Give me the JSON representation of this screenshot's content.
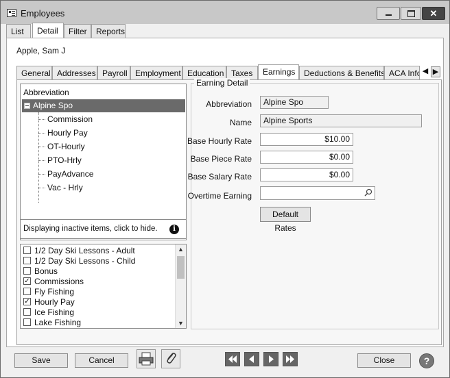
{
  "window": {
    "title": "Employees"
  },
  "top_tabs": [
    {
      "label": "List"
    },
    {
      "label": "Detail"
    },
    {
      "label": "Filter"
    },
    {
      "label": "Reports"
    }
  ],
  "employee": {
    "name": "Apple, Sam J"
  },
  "sub_tabs": [
    {
      "label": "General"
    },
    {
      "label": "Addresses"
    },
    {
      "label": "Payroll"
    },
    {
      "label": "Employment"
    },
    {
      "label": "Education"
    },
    {
      "label": "Taxes"
    },
    {
      "label": "Earnings"
    },
    {
      "label": "Deductions & Benefits"
    },
    {
      "label": "ACA Info"
    }
  ],
  "tree": {
    "header": "Abbreviation",
    "root": "Alpine Spo",
    "children": [
      "Commission",
      "Hourly Pay",
      "OT-Hourly",
      "PTO-Hrly",
      "PayAdvance",
      "Vac - Hrly"
    ]
  },
  "inactive_notice": "Displaying inactive items, click to hide.",
  "checklist": [
    {
      "label": "1/2 Day Ski Lessons - Adult",
      "checked": false
    },
    {
      "label": "1/2 Day Ski Lessons - Child",
      "checked": false
    },
    {
      "label": "Bonus",
      "checked": false
    },
    {
      "label": "Commissions",
      "checked": true
    },
    {
      "label": "Fly Fishing",
      "checked": false
    },
    {
      "label": "Hourly Pay",
      "checked": true
    },
    {
      "label": "Ice Fishing",
      "checked": false
    },
    {
      "label": "Lake Fishing",
      "checked": false
    }
  ],
  "detail": {
    "group_title": "Earning Detail",
    "abbreviation_label": "Abbreviation",
    "abbreviation_value": "Alpine Spo",
    "name_label": "Name",
    "name_value": "Alpine Sports",
    "hourly_label": "Base Hourly Rate",
    "hourly_value": "$10.00",
    "piece_label": "Base Piece Rate",
    "piece_value": "$0.00",
    "salary_label": "Base Salary Rate",
    "salary_value": "$0.00",
    "overtime_label": "Overtime Earning",
    "overtime_value": "",
    "default_rates_label": "Default Rates"
  },
  "footer": {
    "save_label": "Save",
    "cancel_label": "Cancel",
    "close_label": "Close",
    "help_glyph": "?"
  }
}
